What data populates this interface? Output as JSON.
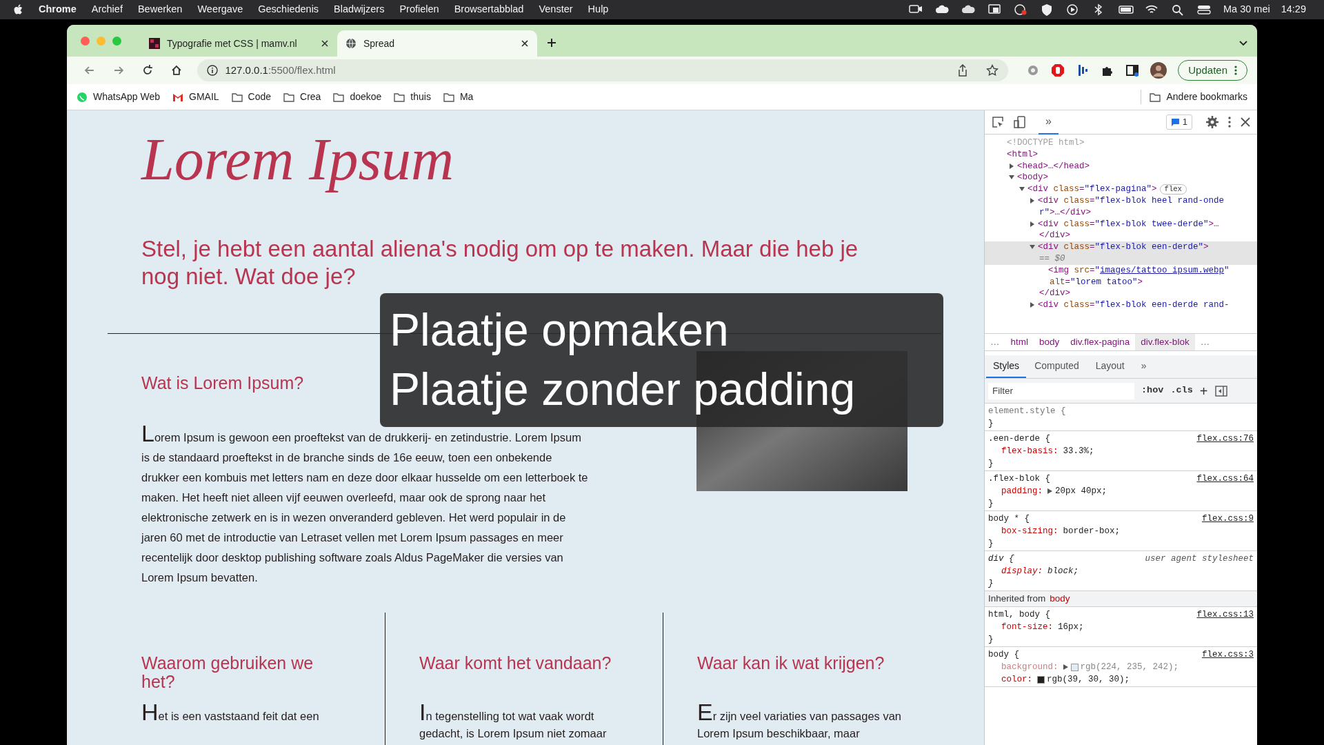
{
  "menu_bar": {
    "app": "Chrome",
    "items": [
      "Archief",
      "Bewerken",
      "Weergave",
      "Geschiedenis",
      "Bladwijzers",
      "Profielen",
      "Browsertabblad",
      "Venster",
      "Hulp"
    ],
    "date": "Ma 30 mei",
    "time": "14:29"
  },
  "tabs": [
    {
      "title": "Typografie met CSS | mamv.nl",
      "kind": "site",
      "selected": false
    },
    {
      "title": "Spread",
      "kind": "globe",
      "selected": true
    }
  ],
  "address_bar": {
    "host": "127.0.0.1",
    "path": ":5500/flex.html"
  },
  "update_button": "Updaten",
  "bookmarks": [
    {
      "label": "WhatsApp Web",
      "kind": "chat"
    },
    {
      "label": "GMAIL",
      "kind": "mail"
    },
    {
      "label": "Code",
      "kind": "folder"
    },
    {
      "label": "Crea",
      "kind": "folder"
    },
    {
      "label": "doekoe",
      "kind": "folder"
    },
    {
      "label": "thuis",
      "kind": "folder"
    },
    {
      "label": "Ma",
      "kind": "folder"
    }
  ],
  "other_bookmarks": "Andere bookmarks",
  "page": {
    "title": "Lorem Ipsum",
    "intro": "Stel, je hebt een aantal aliena's nodig om op te maken. Maar die heb je nog niet. Wat doe je?",
    "section": {
      "heading": "Wat is Lorem Ipsum?",
      "text": "Lorem Ipsum is gewoon een proeftekst van de drukkerij- en zetindustrie. Lorem Ipsum is de standaard proeftekst in de branche sinds de 16e eeuw, toen een onbekende drukker een kombuis met letters nam en deze door elkaar husselde om een letterboek te maken. Het heeft niet alleen vijf eeuwen overleefd, maar ook de sprong naar het elektronische zetwerk en is in wezen onveranderd gebleven. Het werd populair in de jaren 60 met de introductie van Letraset vellen met Lorem Ipsum passages en meer recentelijk door desktop publishing software zoals Aldus PageMaker die versies van Lorem Ipsum bevatten."
    },
    "columns": [
      {
        "heading": "Waarom gebruiken we het?",
        "text": "Het is een vaststaand feit dat een"
      },
      {
        "heading": "Waar komt het vandaan?",
        "text": "In tegenstelling tot wat vaak wordt gedacht, is Lorem Ipsum niet zomaar"
      },
      {
        "heading": "Waar kan ik wat krijgen?",
        "text": "Er zijn veel variaties van passages van Lorem Ipsum beschikbaar, maar"
      }
    ]
  },
  "overlay": {
    "lines": [
      "Plaatje opmaken",
      "Plaatje zonder padding"
    ]
  },
  "devtools": {
    "more_tabs": "»",
    "issues_count": "1",
    "tree": [
      {
        "selected": false,
        "lines": [
          [
            {
              "kind": "doctype",
              "text": "<!DOCTYPE html>"
            }
          ]
        ]
      },
      {
        "selected": false,
        "lines": [
          [
            {
              "kind": "tag",
              "text": "<html>"
            }
          ]
        ],
        "children": [
          {
            "selected": false,
            "expanded": false,
            "lines": [
              [
                {
                  "kind": "tag",
                  "text": "<head>…</head>"
                }
              ]
            ]
          },
          {
            "selected": false,
            "expanded": true,
            "lines": [
              [
                {
                  "kind": "tag",
                  "text": "<body>"
                }
              ]
            ],
            "children": [
              {
                "selected": false,
                "expanded": true,
                "badge": "flex",
                "lines": [
                  [
                    {
                      "kind": "tag",
                      "text": "<div "
                    },
                    {
                      "kind": "attr",
                      "text": "class"
                    },
                    {
                      "kind": "tag",
                      "text": "="
                    },
                    {
                      "kind": "value",
                      "text": "\"flex-pagina\""
                    },
                    {
                      "kind": "tag",
                      "text": ">"
                    }
                  ]
                ],
                "children": [
                  {
                    "selected": false,
                    "expanded": false,
                    "lines": [
                      [
                        {
                          "kind": "tag",
                          "text": "<div "
                        },
                        {
                          "kind": "attr",
                          "text": "class"
                        },
                        {
                          "kind": "tag",
                          "text": "="
                        },
                        {
                          "kind": "value",
                          "text": "\"flex-blok heel rand-onde"
                        }
                      ],
                      [
                        {
                          "kind": "value",
                          "text": "r\""
                        },
                        {
                          "kind": "tag",
                          "text": ">…</div>"
                        }
                      ]
                    ]
                  },
                  {
                    "selected": false,
                    "expanded": false,
                    "lines": [
                      [
                        {
                          "kind": "tag",
                          "text": "<div "
                        },
                        {
                          "kind": "attr",
                          "text": "class"
                        },
                        {
                          "kind": "tag",
                          "text": "="
                        },
                        {
                          "kind": "value",
                          "text": "\"flex-blok twee-derde\""
                        },
                        {
                          "kind": "tag",
                          "text": ">…"
                        }
                      ],
                      [
                        {
                          "kind": "tag",
                          "text": "</div>"
                        }
                      ]
                    ]
                  },
                  {
                    "selected": true,
                    "expanded": true,
                    "lines": [
                      [
                        {
                          "kind": "tag",
                          "text": "<div "
                        },
                        {
                          "kind": "attr",
                          "text": "class"
                        },
                        {
                          "kind": "tag",
                          "text": "="
                        },
                        {
                          "kind": "value",
                          "text": "\"flex-blok een-derde\""
                        },
                        {
                          "kind": "tag",
                          "text": ">"
                        }
                      ],
                      [
                        {
                          "kind": "ref",
                          "text": "== $0"
                        }
                      ]
                    ],
                    "closing": "</div>",
                    "children": [
                      {
                        "selected": false,
                        "lines": [
                          [
                            {
                              "kind": "tag",
                              "text": "<img "
                            },
                            {
                              "kind": "attr",
                              "text": "src"
                            },
                            {
                              "kind": "tag",
                              "text": "="
                            },
                            {
                              "kind": "value",
                              "text": "\""
                            },
                            {
                              "kind": "link",
                              "text": "images/tattoo ipsum.webp"
                            },
                            {
                              "kind": "value",
                              "text": "\""
                            }
                          ],
                          [
                            {
                              "kind": "attr",
                              "text": "alt"
                            },
                            {
                              "kind": "tag",
                              "text": "="
                            },
                            {
                              "kind": "value",
                              "text": "\"lorem tatoo\""
                            },
                            {
                              "kind": "tag",
                              "text": ">"
                            }
                          ]
                        ]
                      }
                    ]
                  },
                  {
                    "selected": false,
                    "expanded": false,
                    "lines": [
                      [
                        {
                          "kind": "tag",
                          "text": "<div "
                        },
                        {
                          "kind": "attr",
                          "text": "class"
                        },
                        {
                          "kind": "tag",
                          "text": "="
                        },
                        {
                          "kind": "value",
                          "text": "\"flex-blok een-derde rand-"
                        }
                      ]
                    ]
                  }
                ]
              }
            ]
          }
        ]
      }
    ],
    "breadcrumbs": [
      {
        "text": "…",
        "kind": "more",
        "selected": false
      },
      {
        "text": "html",
        "kind": "crumb",
        "selected": false
      },
      {
        "text": "body",
        "kind": "crumb",
        "selected": false
      },
      {
        "text": "div.flex-pagina",
        "kind": "crumb",
        "selected": false
      },
      {
        "text": "div.flex-blok",
        "kind": "crumb",
        "selected": true
      },
      {
        "text": "…",
        "kind": "more",
        "selected": false
      }
    ],
    "style_tabs": [
      {
        "label": "Styles",
        "selected": true
      },
      {
        "label": "Computed",
        "selected": false
      },
      {
        "label": "Layout",
        "selected": false
      },
      {
        "label": "»",
        "selected": false
      }
    ],
    "filter": {
      "placeholder": "Filter"
    },
    "hov": ":hov",
    "cls": ".cls",
    "add": "+",
    "rules": [
      {
        "selector": "element.style {",
        "kind": "inline",
        "close": "}"
      },
      {
        "selector": ".een-derde {",
        "kind": "file",
        "source": "flex.css:76",
        "declarations": [
          {
            "prop": "flex-basis:",
            "value": "33.3%;"
          }
        ],
        "close": "}"
      },
      {
        "selector": ".flex-blok {",
        "kind": "file",
        "source": "flex.css:64",
        "declarations": [
          {
            "prop": "padding:",
            "value": "20px 40px;",
            "expandable": true
          }
        ],
        "close": "}"
      },
      {
        "selector": "body * {",
        "kind": "file",
        "source": "flex.css:9",
        "declarations": [
          {
            "prop": "box-sizing:",
            "value": "border-box;"
          }
        ],
        "close": "}"
      },
      {
        "selector": "div {",
        "kind": "ua",
        "source": "user agent stylesheet",
        "declarations": [
          {
            "prop": "display:",
            "value": "block;"
          }
        ],
        "close": "}"
      },
      {
        "kind": "inherited",
        "label": "Inherited from",
        "from": "body"
      },
      {
        "selector": "html, body {",
        "kind": "file",
        "source": "flex.css:13",
        "declarations": [
          {
            "prop": "font-size:",
            "value": "16px;"
          }
        ],
        "close": "}"
      },
      {
        "selector": "body {",
        "kind": "file",
        "source": "flex.css:3",
        "declarations": [
          {
            "prop": "background:",
            "value": "rgb(224, 235, 242);",
            "expandable": true,
            "faded": true,
            "swatch": true
          },
          {
            "prop": "color:",
            "value": "rgb(39, 30, 30);",
            "swatch": true
          }
        ]
      }
    ]
  }
}
